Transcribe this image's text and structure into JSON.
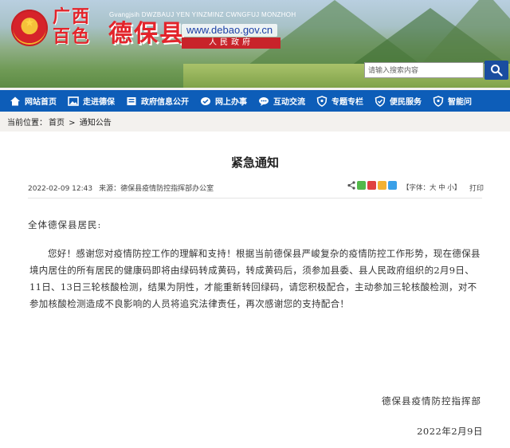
{
  "header": {
    "region_line1": "广西",
    "region_line2": "百色",
    "pinyin": "Gvangjsih DWZBAUJ YEN YINZMINZ CWNGFUJ MONZHOH",
    "county": "德保县",
    "url": "www.debao.gov.cn",
    "gov_label": "人民政府",
    "search_placeholder": "请输入搜索内容"
  },
  "nav": {
    "items": [
      {
        "label": "网站首页",
        "icon": "home-icon"
      },
      {
        "label": "走进德保",
        "icon": "picture-icon"
      },
      {
        "label": "政府信息公开",
        "icon": "document-icon"
      },
      {
        "label": "网上办事",
        "icon": "hand-icon"
      },
      {
        "label": "互动交流",
        "icon": "chat-icon"
      },
      {
        "label": "专题专栏",
        "icon": "shield-icon"
      },
      {
        "label": "便民服务",
        "icon": "shield-check-icon"
      },
      {
        "label": "智能问",
        "icon": "shield-icon"
      }
    ]
  },
  "breadcrumb": {
    "prefix": "当前位置：",
    "home": "首页",
    "separator": " > ",
    "current": "通知公告"
  },
  "article": {
    "title": "紧急通知",
    "datetime": "2022-02-09 12:43",
    "source": "来源：德保县疫情防控指挥部办公室",
    "font_size_label": "【字体：大 中 小】",
    "print_label": "打印",
    "salutation": "全体德保县居民:",
    "body": "您好！感谢您对疫情防控工作的理解和支持！根据当前德保县严峻复杂的疫情防控工作形势，现在德保县境内居住的所有居民的健康码即将由绿码转成黄码，转成黄码后，须参加县委、县人民政府组织的2月9日、11日、13日三轮核酸检测，结果为阴性，才能重新转回绿码，请您积极配合，主动参加三轮核酸检测，对不参加核酸检测造成不良影响的人员将追究法律责任，再次感谢您的支持配合！",
    "signature": "德保县疫情防控指挥部",
    "date": "2022年2月9日"
  },
  "colors": {
    "nav_bg": "#0d5db8",
    "brand_red": "#e3242b",
    "search_btn": "#1a4da0"
  }
}
